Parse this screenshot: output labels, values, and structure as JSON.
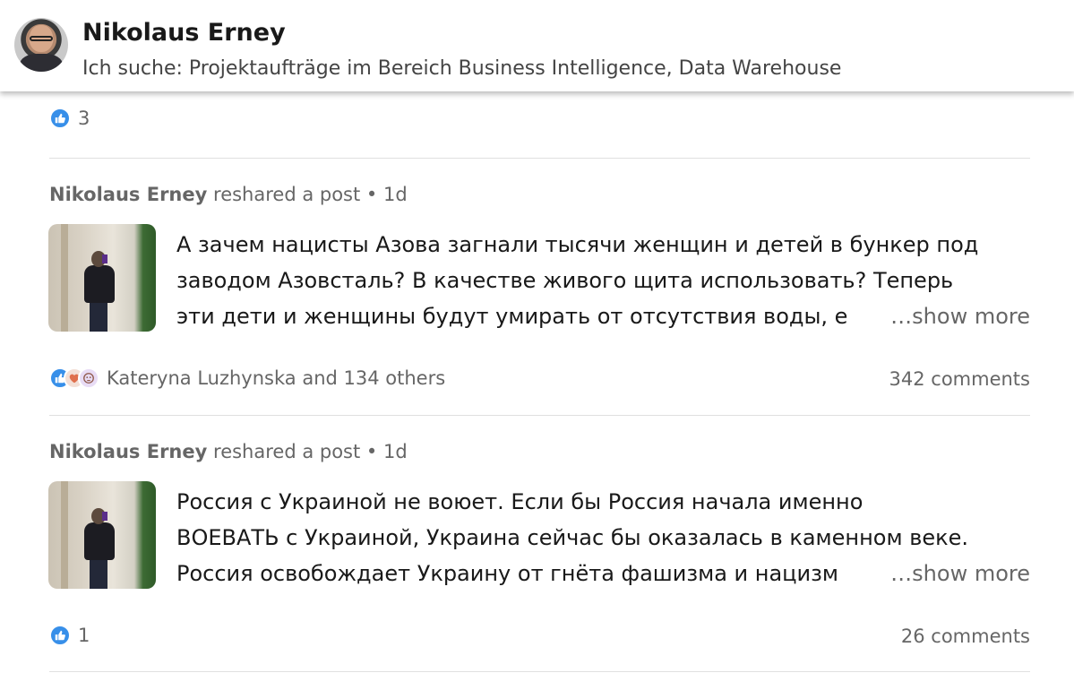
{
  "header": {
    "name": "Nikolaus Erney",
    "headline": "Ich suche: Projektaufträge im Bereich Business Intelligence, Data Warehouse"
  },
  "top_item": {
    "reactions": "3"
  },
  "posts": [
    {
      "author": "Nikolaus Erney",
      "action": "reshared a post",
      "time": "1d",
      "lines": [
        "А зачем нацисты Азова загнали тысячи женщин и детей в бункер под",
        "заводом Азовсталь? В качестве живого щита использовать? Теперь",
        "эти дети и женщины будут умирать от отсутствия воды, е"
      ],
      "show_more": "…show more",
      "reactions_text": "Kateryna Luzhynska and 134 others",
      "reaction_icons": [
        "like-icon",
        "love-icon",
        "curious-icon"
      ],
      "comments": "342 comments"
    },
    {
      "author": "Nikolaus Erney",
      "action": "reshared a post",
      "time": "1d",
      "lines": [
        "Россия с Украиной не воюет. Если бы Россия начала именно",
        "ВОЕВАТЬ с Украиной, Украина сейчас бы оказалась в каменном веке.",
        "Россия освобождает Украину от гнёта фашизма и нацизм"
      ],
      "show_more": "…show more",
      "reactions_text": "1",
      "reaction_icons": [
        "like-icon"
      ],
      "comments": "26 comments"
    }
  ],
  "separator": "•",
  "colors": {
    "like_blue": "#378fe9",
    "text_secondary": "#666666"
  }
}
